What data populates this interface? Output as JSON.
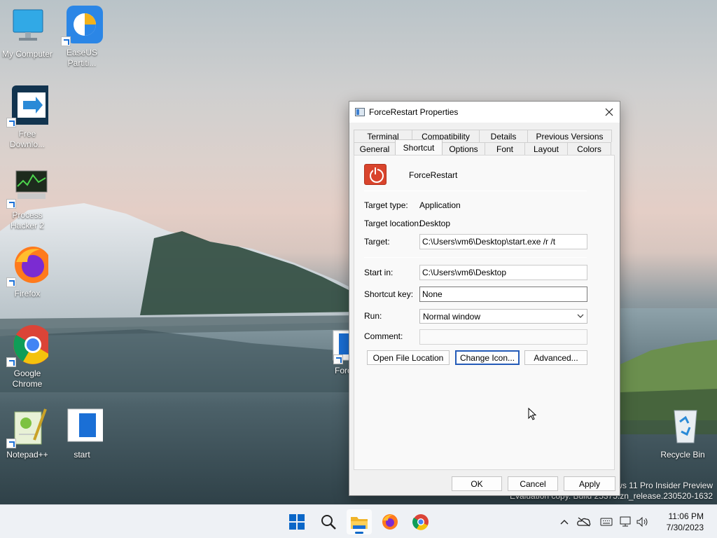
{
  "desktop": {
    "icons": [
      {
        "label": "My Computer",
        "icon": "monitor-icon"
      },
      {
        "label": "EaseUS Partiti...",
        "icon": "easeus-icon"
      },
      {
        "label": "Free Downlo...",
        "icon": "free-download-icon"
      },
      {
        "label": "Process Hacker 2",
        "icon": "process-hacker-icon"
      },
      {
        "label": "Firefox",
        "icon": "firefox-icon"
      },
      {
        "label": "Google Chrome",
        "icon": "chrome-icon"
      },
      {
        "label": "Notepad++",
        "icon": "notepadpp-icon"
      },
      {
        "label": "start",
        "icon": "document-icon"
      },
      {
        "label": "Recycle Bin",
        "icon": "recycle-bin-icon"
      },
      {
        "label": "Forc",
        "icon": "document-icon"
      }
    ],
    "watermark_line1": "ws 11 Pro Insider Preview",
    "watermark_line2": "Evaluation copy. Build 25375.zn_release.230520-1632"
  },
  "dialog": {
    "title": "ForceRestart Properties",
    "tabs_row1": [
      "Terminal",
      "Compatibility",
      "Details",
      "Previous Versions"
    ],
    "tabs_row2": [
      "General",
      "Shortcut",
      "Options",
      "Font",
      "Layout",
      "Colors"
    ],
    "active_tab": "Shortcut",
    "app_name": "ForceRestart",
    "target_type_label": "Target type:",
    "target_type_value": "Application",
    "target_location_label": "Target location:",
    "target_location_value": "Desktop",
    "target_label": "Target:",
    "target_value": "C:\\Users\\vm6\\Desktop\\start.exe /r /t",
    "start_in_label": "Start in:",
    "start_in_value": "C:\\Users\\vm6\\Desktop",
    "shortcut_key_label": "Shortcut key:",
    "shortcut_key_value": "None",
    "run_label": "Run:",
    "run_value": "Normal window",
    "comment_label": "Comment:",
    "comment_value": "",
    "open_file_location": "Open File Location",
    "change_icon": "Change Icon...",
    "advanced": "Advanced...",
    "ok": "OK",
    "cancel": "Cancel",
    "apply": "Apply"
  },
  "taskbar": {
    "apps": [
      "start-icon",
      "search-icon",
      "file-explorer-icon",
      "firefox-icon",
      "chrome-icon"
    ],
    "time": "11:06 PM",
    "date": "7/30/2023"
  }
}
